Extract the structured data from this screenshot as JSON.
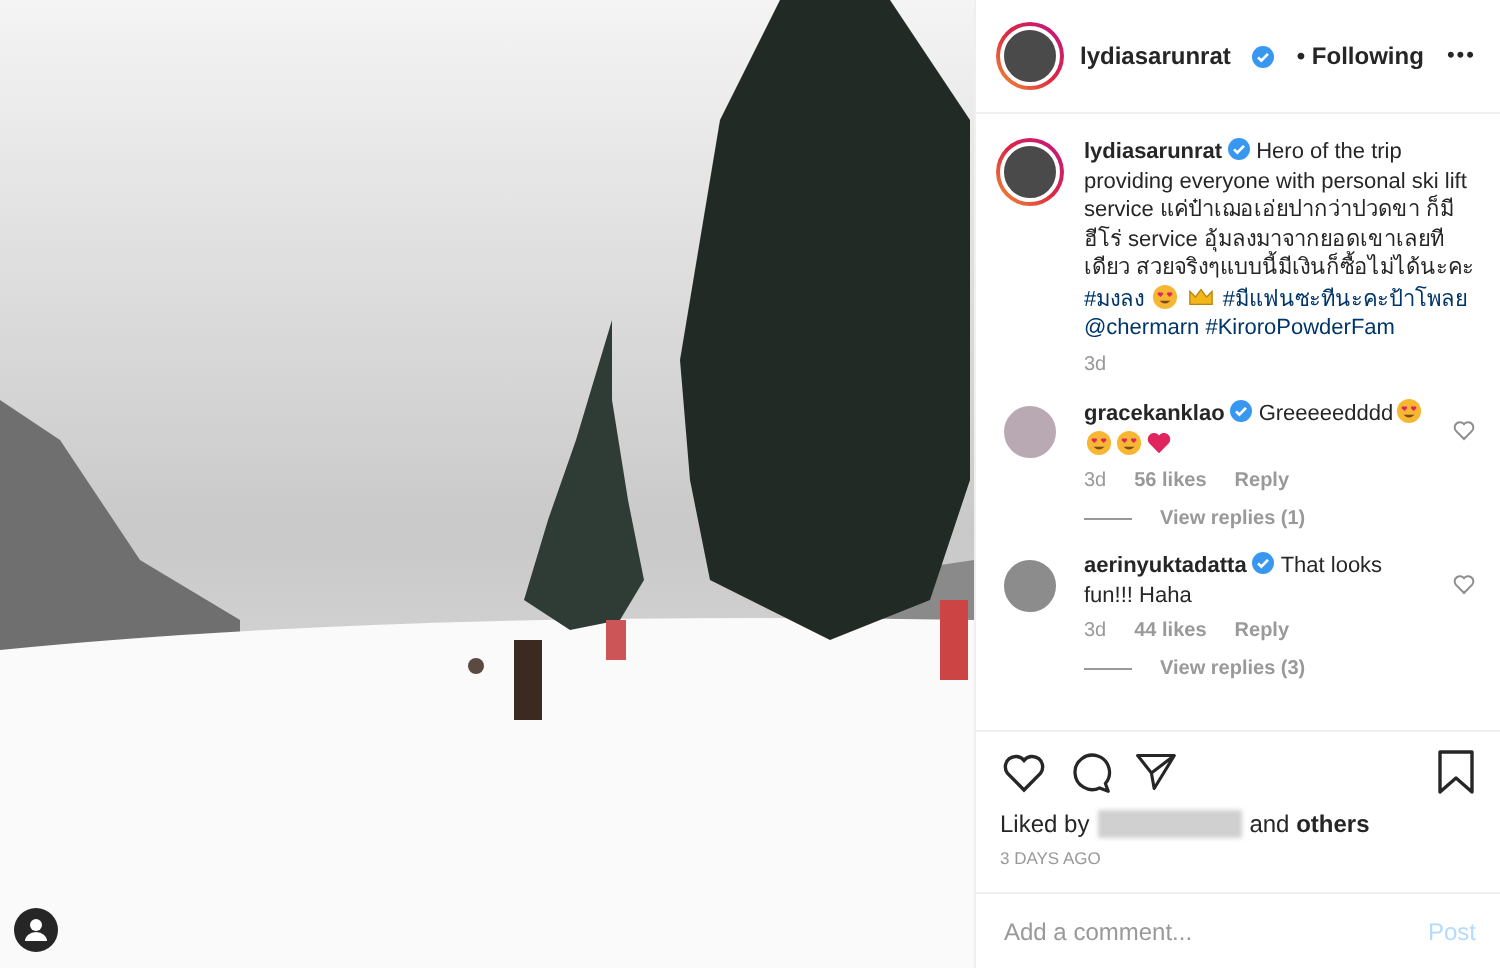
{
  "post": {
    "author": "lydiasarunrat",
    "verified": true,
    "separator": "•",
    "follow_status": "Following",
    "menu": "•••"
  },
  "caption": {
    "author": "lydiasarunrat",
    "verified": true,
    "segments": [
      {
        "kind": "text",
        "text": "Hero of the trip providing everyone with personal ski lift service แค่ป๋าเฌอเอ่ยปากว่าปวดขา ก็มีฮีโร่ service อุ้มลงมาจากยอดเขาเลยทีเดียว สวยจริงๆแบบนี้มีเงินก็ซื้อไม่ได้นะคะ"
      },
      {
        "kind": "tag",
        "text": "#มงลง"
      },
      {
        "kind": "face"
      },
      {
        "kind": "crown"
      },
      {
        "kind": "tag",
        "text": "#มีแฟนซะทีนะคะป้าโพลย"
      },
      {
        "kind": "tag",
        "text": "@chermarn"
      },
      {
        "kind": "tag",
        "text": "#KiroroPowderFam"
      }
    ],
    "time": "3d"
  },
  "comments": [
    {
      "author": "gracekanklao",
      "verified": true,
      "segments": [
        {
          "kind": "text",
          "text": "Greeeeedddd"
        },
        {
          "kind": "face"
        },
        {
          "kind": "face"
        },
        {
          "kind": "face"
        },
        {
          "kind": "heart"
        }
      ],
      "time": "3d",
      "likes": "56 likes",
      "reply": "Reply",
      "view_replies": "View replies (1)",
      "liked": false
    },
    {
      "author": "aerinyuktadatta",
      "verified": true,
      "segments": [
        {
          "kind": "text",
          "text": "That looks fun!!! Haha"
        }
      ],
      "time": "3d",
      "likes": "44 likes",
      "reply": "Reply",
      "view_replies": "View replies (3)",
      "liked": false
    }
  ],
  "actions": {
    "liked": false,
    "saved": false
  },
  "likes": {
    "prefix": "Liked by",
    "suffix": "and **others**"
  },
  "date": "3 DAYS AGO",
  "add_comment": {
    "placeholder": "Add a comment...",
    "button": "Post"
  }
}
